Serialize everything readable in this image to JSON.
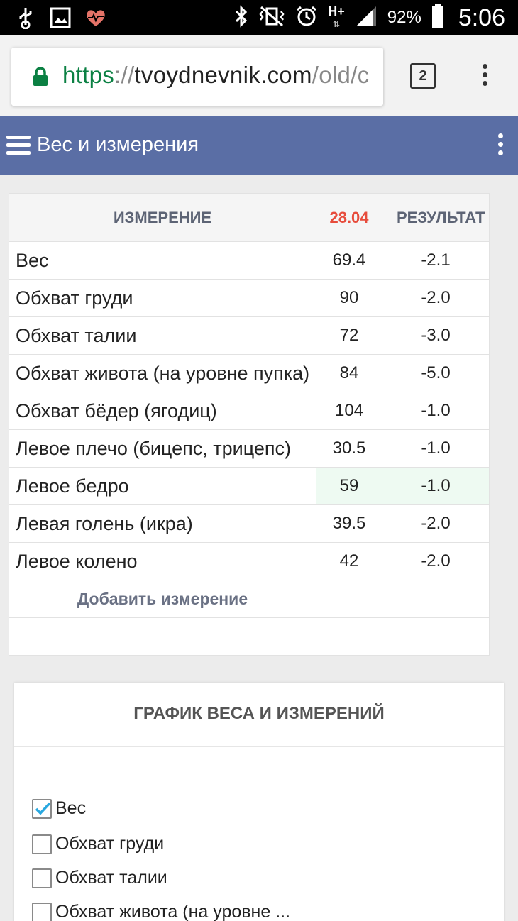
{
  "status_bar": {
    "battery_pct": "92%",
    "time": "5:06",
    "network": "H+",
    "icons_left": [
      "usb-icon",
      "image-icon",
      "heart-rate-icon"
    ],
    "icons_right": [
      "bluetooth-icon",
      "vibrate-icon",
      "alarm-icon",
      "signal-icon",
      "battery-icon"
    ]
  },
  "browser": {
    "url_scheme": "https",
    "url_sep": "://",
    "url_host": "tvoydnevnik.com",
    "url_path": "/old/c",
    "tab_count": "2"
  },
  "app_bar": {
    "title": "Вес и измерения"
  },
  "table": {
    "headers": {
      "measurement": "ИЗМЕРЕНИЕ",
      "date": "28.04",
      "result": "РЕЗУЛЬТАТ"
    },
    "rows": [
      {
        "name": "Вес",
        "value": "69.4",
        "result": "-2.1"
      },
      {
        "name": "Обхват груди",
        "value": "90",
        "result": "-2.0"
      },
      {
        "name": "Обхват талии",
        "value": "72",
        "result": "-3.0"
      },
      {
        "name": "Обхват живота (на уровне пупка)",
        "value": "84",
        "result": "-5.0"
      },
      {
        "name": "Обхват бёдер (ягодиц)",
        "value": "104",
        "result": "-1.0"
      },
      {
        "name": "Левое плечо (бицепс, трицепс)",
        "value": "30.5",
        "result": "-1.0"
      },
      {
        "name": "Левое бедро",
        "value": "59",
        "result": "-1.0"
      },
      {
        "name": "Левая голень (икра)",
        "value": "39.5",
        "result": "-2.0"
      },
      {
        "name": "Левое колено",
        "value": "42",
        "result": "-2.0"
      }
    ],
    "add_label": "Добавить измерение"
  },
  "chart_card": {
    "title": "ГРАФИК ВЕСА И ИЗМЕРЕНИЙ",
    "options": [
      {
        "label": "Вес",
        "checked": true
      },
      {
        "label": "Обхват груди",
        "checked": false
      },
      {
        "label": "Обхват талии",
        "checked": false
      },
      {
        "label": "Обхват живота (на уровне ...",
        "checked": false
      }
    ]
  },
  "colors": {
    "app_bar": "#5a6ea5",
    "date_header": "#e74c3c",
    "url_scheme": "#0b8043",
    "checkbox_accent": "#29a8e0"
  }
}
